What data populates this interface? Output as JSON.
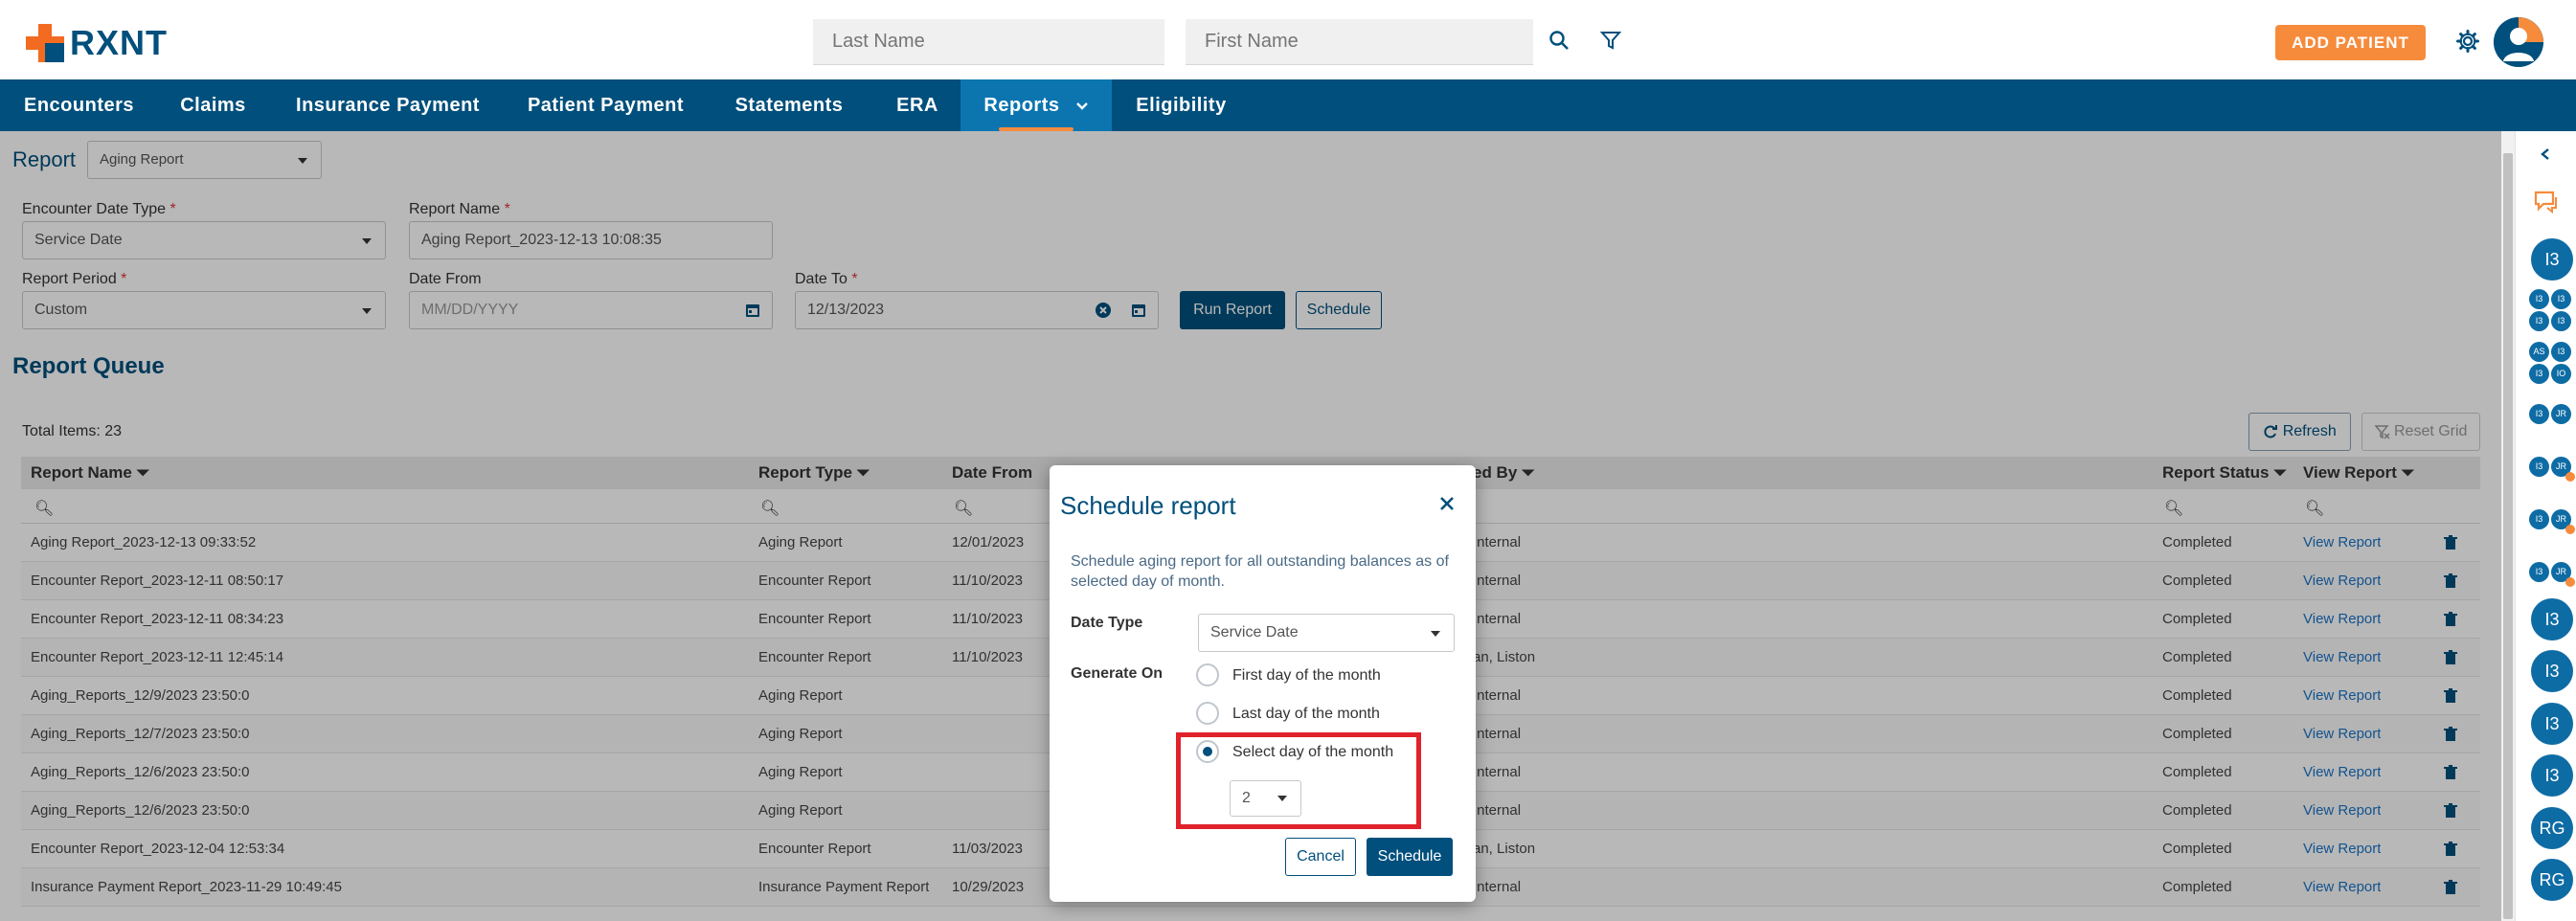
{
  "header": {
    "logo_text": "RXNT",
    "last_name_placeholder": "Last Name",
    "first_name_placeholder": "First Name",
    "add_patient_label": "ADD PATIENT"
  },
  "nav": {
    "items": [
      "Encounters",
      "Claims",
      "Insurance Payment",
      "Patient Payment",
      "Statements",
      "ERA",
      "Reports",
      "Eligibility"
    ],
    "active": "Reports"
  },
  "report_form": {
    "report_label": "Report",
    "report_value": "Aging Report",
    "encounter_date_type_label": "Encounter Date Type",
    "encounter_date_type_value": "Service Date",
    "report_name_label": "Report Name",
    "report_name_value": "Aging Report_2023-12-13 10:08:35",
    "report_period_label": "Report Period",
    "report_period_value": "Custom",
    "date_from_label": "Date From",
    "date_from_placeholder": "MM/DD/YYYY",
    "date_to_label": "Date To",
    "date_to_value": "12/13/2023",
    "required_mark": "*",
    "run_report_label": "Run Report",
    "schedule_label": "Schedule"
  },
  "queue": {
    "title": "Report Queue",
    "total_items": "Total Items: 23",
    "refresh_label": "Refresh",
    "reset_grid_label": "Reset Grid",
    "columns": {
      "report_name": "Report Name",
      "report_type": "Report Type",
      "date_from": "Date From",
      "requested_by": "ed By",
      "report_status": "Report Status",
      "view_report": "View Report"
    },
    "rows": [
      {
        "name": "Aging Report_2023-12-13 09:33:52",
        "type": "Aging Report",
        "from": "12/01/2023",
        "by": "Internal",
        "status": "Completed",
        "view": "View Report"
      },
      {
        "name": "Encounter Report_2023-12-11 08:50:17",
        "type": "Encounter Report",
        "from": "11/10/2023",
        "by": "Internal",
        "status": "Completed",
        "view": "View Report"
      },
      {
        "name": "Encounter Report_2023-12-11 08:34:23",
        "type": "Encounter Report",
        "from": "11/10/2023",
        "by": "Internal",
        "status": "Completed",
        "view": "View Report"
      },
      {
        "name": "Encounter Report_2023-12-11 12:45:14",
        "type": "Encounter Report",
        "from": "11/10/2023",
        "by": "an, Liston",
        "status": "Completed",
        "view": "View Report"
      },
      {
        "name": "Aging_Reports_12/9/2023 23:50:0",
        "type": "Aging Report",
        "from": "",
        "by": "Internal",
        "status": "Completed",
        "view": "View Report"
      },
      {
        "name": "Aging_Reports_12/7/2023 23:50:0",
        "type": "Aging Report",
        "from": "",
        "by": "Internal",
        "status": "Completed",
        "view": "View Report"
      },
      {
        "name": "Aging_Reports_12/6/2023 23:50:0",
        "type": "Aging Report",
        "from": "",
        "by": "Internal",
        "status": "Completed",
        "view": "View Report"
      },
      {
        "name": "Aging_Reports_12/6/2023 23:50:0",
        "type": "Aging Report",
        "from": "",
        "by": "Internal",
        "status": "Completed",
        "view": "View Report"
      },
      {
        "name": "Encounter Report_2023-12-04 12:53:34",
        "type": "Encounter Report",
        "from": "11/03/2023",
        "by": "an, Liston",
        "status": "Completed",
        "view": "View Report"
      },
      {
        "name": "Insurance Payment Report_2023-11-29 10:49:45",
        "type": "Insurance Payment Report",
        "from": "10/29/2023",
        "by": "Internal",
        "status": "Completed",
        "view": "View Report"
      }
    ]
  },
  "rail": {
    "badges": [
      "I3",
      "I3",
      "I3",
      "I3",
      "I3",
      "RG",
      "RG"
    ],
    "mini_badges": [
      "I3",
      "I3",
      "I3",
      "I3",
      "AS",
      "I3",
      "I3",
      "IO",
      "I3",
      "JR",
      "I3",
      "JR",
      "I3",
      "JR",
      "I3",
      "JR"
    ]
  },
  "modal": {
    "title": "Schedule report",
    "description": "Schedule aging report for all outstanding balances as of selected day of month.",
    "date_type_label": "Date Type",
    "date_type_value": "Service Date",
    "generate_on_label": "Generate On",
    "options": [
      "First day of the month",
      "Last day of the month",
      "Select day of the month"
    ],
    "selected_option": "Select day of the month",
    "day_value": "2",
    "cancel_label": "Cancel",
    "schedule_label": "Schedule"
  },
  "colors": {
    "brand_blue": "#004f7c",
    "brand_orange": "#f68b3c",
    "highlight_red": "#e0222b"
  }
}
